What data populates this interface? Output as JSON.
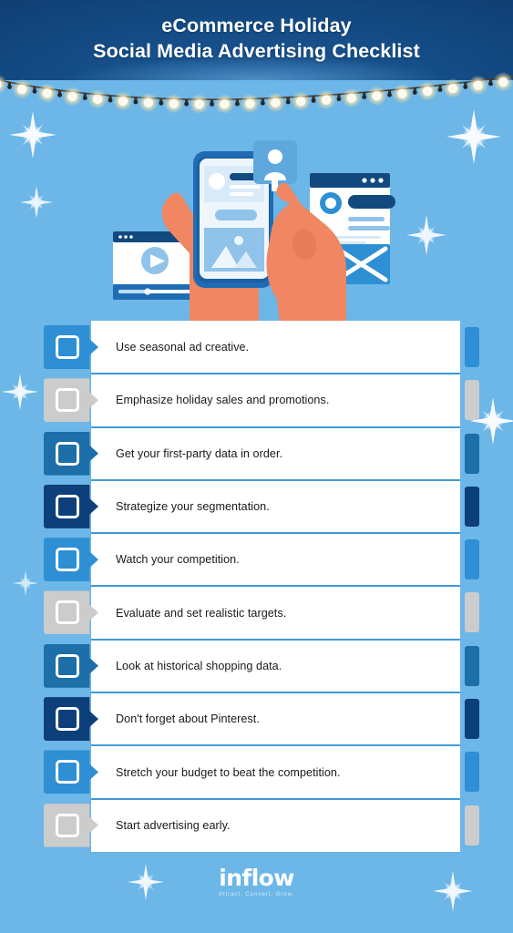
{
  "header": {
    "title_line_1": "eCommerce Holiday",
    "title_line_2": "Social Media Advertising Checklist",
    "band_color": "#0f3f74",
    "decoration": "string-lights"
  },
  "background": {
    "color": "#6cb6e8",
    "sparkle_count": 9
  },
  "illustration": {
    "name": "hands-holding-phone-social-media",
    "elements": [
      "video-player-window",
      "smartphone-social-post",
      "profile-card",
      "browser-window",
      "email-envelope",
      "left-hand",
      "right-hand-pointing"
    ],
    "skin_color": "#f08662",
    "phone_frame_color": "#1f6cb5",
    "accent_dark": "#123f72"
  },
  "checklist": {
    "items": [
      {
        "label": "Use seasonal ad creative.",
        "tab_color": "#2e8fd4",
        "stub_color": "#2e8fd4",
        "checkbox_fill": "#2e8fd4"
      },
      {
        "label": "Emphasize holiday sales and promotions.",
        "tab_color": "#cccccc",
        "stub_color": "#cccccc",
        "checkbox_fill": "#cccccc"
      },
      {
        "label": "Get your first-party data in order.",
        "tab_color": "#1c6fa8",
        "stub_color": "#1c6fa8",
        "checkbox_fill": "#1c6fa8"
      },
      {
        "label": "Strategize your segmentation.",
        "tab_color": "#0d3f7a",
        "stub_color": "#0d3f7a",
        "checkbox_fill": "#0d3f7a"
      },
      {
        "label": "Watch your competition.",
        "tab_color": "#2e8fd4",
        "stub_color": "#2e8fd4",
        "checkbox_fill": "#2e8fd4"
      },
      {
        "label": "Evaluate and set realistic targets.",
        "tab_color": "#cccccc",
        "stub_color": "#cccccc",
        "checkbox_fill": "#cccccc"
      },
      {
        "label": "Look at historical shopping data.",
        "tab_color": "#1c6fa8",
        "stub_color": "#1c6fa8",
        "checkbox_fill": "#1c6fa8"
      },
      {
        "label": "Don't forget about Pinterest.",
        "tab_color": "#0d3f7a",
        "stub_color": "#0d3f7a",
        "checkbox_fill": "#0d3f7a"
      },
      {
        "label": "Stretch your budget to beat the competition.",
        "tab_color": "#2e8fd4",
        "stub_color": "#2e8fd4",
        "checkbox_fill": "#2e8fd4"
      },
      {
        "label": "Start advertising early.",
        "tab_color": "#cccccc",
        "stub_color": "#cccccc",
        "checkbox_fill": "#cccccc"
      }
    ]
  },
  "footer": {
    "logo_text": "inflow",
    "tagline": "Attract. Convert. Grow."
  }
}
